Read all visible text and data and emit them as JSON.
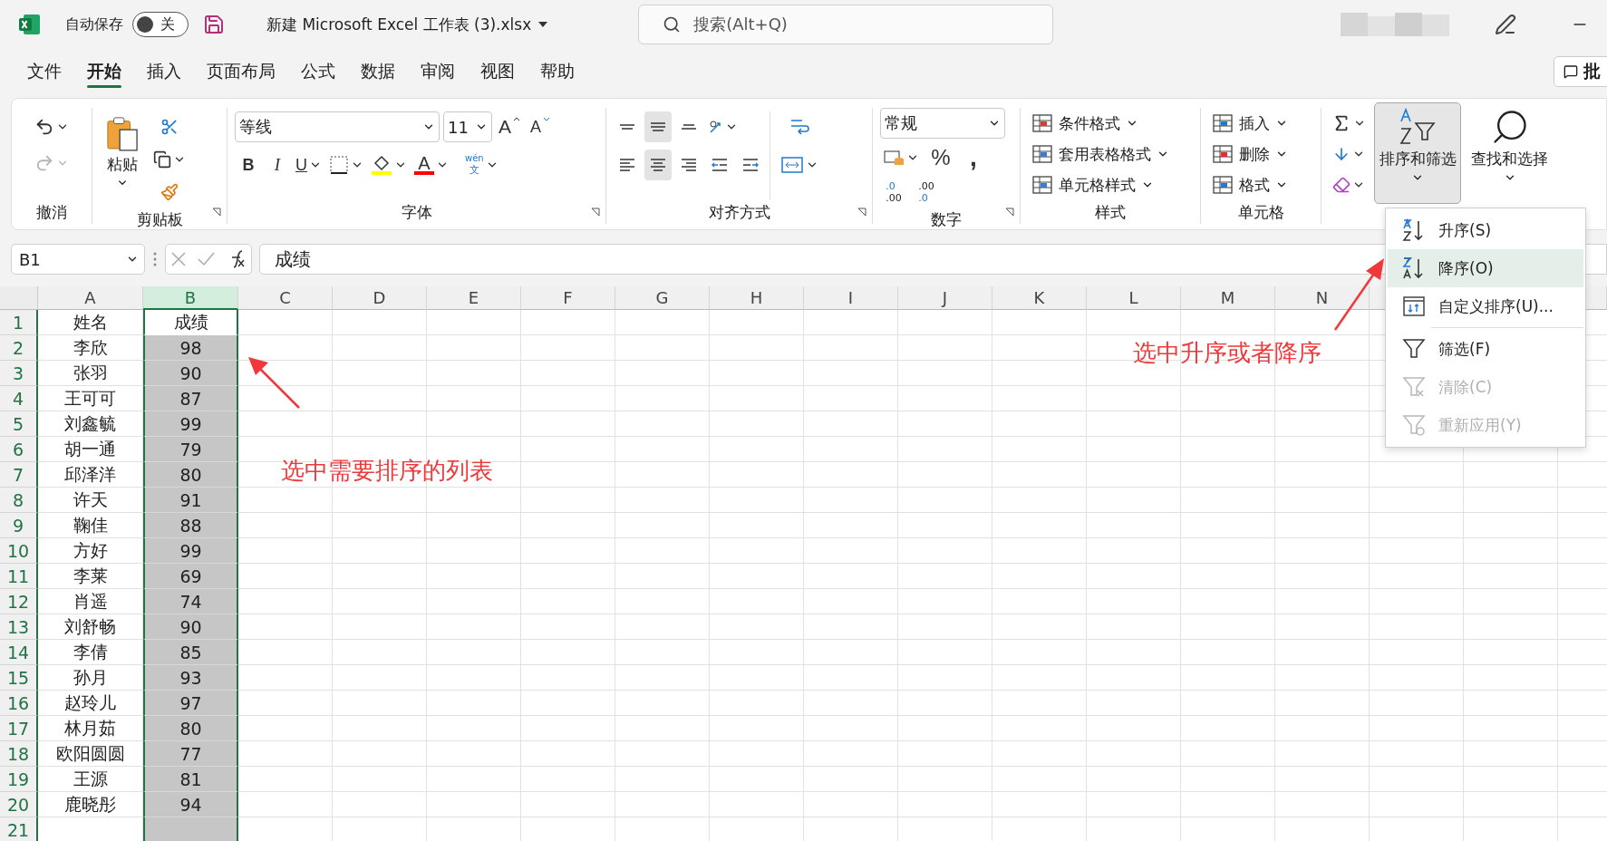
{
  "title_bar": {
    "autosave_label": "自动保存",
    "autosave": {
      "on": false,
      "state_label": "关"
    },
    "file_name": "新建 Microsoft Excel 工作表 (3).xlsx",
    "search_placeholder": "搜索(Alt+Q)"
  },
  "tabs": [
    {
      "label": "文件",
      "selected": false
    },
    {
      "label": "开始",
      "selected": true
    },
    {
      "label": "插入",
      "selected": false
    },
    {
      "label": "页面布局",
      "selected": false
    },
    {
      "label": "公式",
      "selected": false
    },
    {
      "label": "数据",
      "selected": false
    },
    {
      "label": "审阅",
      "selected": false
    },
    {
      "label": "视图",
      "selected": false
    },
    {
      "label": "帮助",
      "selected": false
    }
  ],
  "comment_button": "批",
  "ribbon": {
    "undo": {
      "label": "撤消",
      "redo_disabled": true
    },
    "clipboard": {
      "paste": "粘贴",
      "label": "剪贴板"
    },
    "font": {
      "name": "等线",
      "size": "11",
      "grow": "A",
      "shrink": "A",
      "bold": "B",
      "italic": "I",
      "underline": "U",
      "font_color": "A",
      "phonetic_top": "wén",
      "phonetic_bottom": "文",
      "label": "字体"
    },
    "alignment": {
      "label": "对齐方式",
      "vertical": [
        {
          "kind": "top",
          "selected": false
        },
        {
          "kind": "middle",
          "selected": true
        },
        {
          "kind": "bottom",
          "selected": false
        }
      ],
      "horizontal": [
        {
          "kind": "left",
          "selected": false
        },
        {
          "kind": "center",
          "selected": true
        },
        {
          "kind": "right",
          "selected": false
        },
        {
          "kind": "outdent",
          "selected": false
        },
        {
          "kind": "indent",
          "selected": false
        }
      ]
    },
    "number": {
      "format": "常规",
      "percent": "%",
      "comma": ",",
      "increase_decimal": [
        ".0",
        ".00"
      ],
      "decrease_decimal": [
        ".00",
        ".0"
      ],
      "label": "数字"
    },
    "styles": {
      "label": "样式",
      "items": [
        {
          "kind": "conditional",
          "label": "条件格式"
        },
        {
          "kind": "table",
          "label": "套用表格格式"
        },
        {
          "kind": "cell",
          "label": "单元格样式"
        }
      ]
    },
    "cells": {
      "label": "单元格",
      "items": [
        {
          "kind": "insert",
          "label": "插入"
        },
        {
          "kind": "delete",
          "label": "删除"
        },
        {
          "kind": "format",
          "label": "格式"
        }
      ]
    },
    "editing": {
      "sort_filter": {
        "label": "排序和筛选",
        "pressed": true
      },
      "find": "查找和选择"
    }
  },
  "formula_bar": {
    "name_box": "B1",
    "formula": "成绩"
  },
  "sheet": {
    "columns": [
      {
        "label": "A",
        "selected": false
      },
      {
        "label": "B",
        "selected": true
      },
      {
        "label": "C",
        "selected": false
      },
      {
        "label": "D",
        "selected": false
      },
      {
        "label": "E",
        "selected": false
      },
      {
        "label": "F",
        "selected": false
      },
      {
        "label": "G",
        "selected": false
      },
      {
        "label": "H",
        "selected": false
      },
      {
        "label": "I",
        "selected": false
      },
      {
        "label": "J",
        "selected": false
      },
      {
        "label": "K",
        "selected": false
      },
      {
        "label": "L",
        "selected": false
      },
      {
        "label": "M",
        "selected": false
      },
      {
        "label": "N",
        "selected": false
      }
    ],
    "rows": [
      {
        "number": "1",
        "active": true,
        "cells": [
          "姓名",
          "成绩"
        ]
      },
      {
        "number": "2",
        "active": false,
        "cells": [
          "李欣",
          "98"
        ]
      },
      {
        "number": "3",
        "active": false,
        "cells": [
          "张羽",
          "90"
        ]
      },
      {
        "number": "4",
        "active": false,
        "cells": [
          "王可可",
          "87"
        ]
      },
      {
        "number": "5",
        "active": false,
        "cells": [
          "刘鑫毓",
          "99"
        ]
      },
      {
        "number": "6",
        "active": false,
        "cells": [
          "胡一通",
          "79"
        ]
      },
      {
        "number": "7",
        "active": false,
        "cells": [
          "邱泽洋",
          "80"
        ]
      },
      {
        "number": "8",
        "active": false,
        "cells": [
          "许天",
          "91"
        ]
      },
      {
        "number": "9",
        "active": false,
        "cells": [
          "鞠佳",
          "88"
        ]
      },
      {
        "number": "10",
        "active": false,
        "cells": [
          "方好",
          "99"
        ]
      },
      {
        "number": "11",
        "active": false,
        "cells": [
          "李莱",
          "69"
        ]
      },
      {
        "number": "12",
        "active": false,
        "cells": [
          "肖遥",
          "74"
        ]
      },
      {
        "number": "13",
        "active": false,
        "cells": [
          "刘舒畅",
          "90"
        ]
      },
      {
        "number": "14",
        "active": false,
        "cells": [
          "李倩",
          "85"
        ]
      },
      {
        "number": "15",
        "active": false,
        "cells": [
          "孙月",
          "93"
        ]
      },
      {
        "number": "16",
        "active": false,
        "cells": [
          "赵玲儿",
          "97"
        ]
      },
      {
        "number": "17",
        "active": false,
        "cells": [
          "林月茹",
          "80"
        ]
      },
      {
        "number": "18",
        "active": false,
        "cells": [
          "欧阳圆圆",
          "77"
        ]
      },
      {
        "number": "19",
        "active": false,
        "cells": [
          "王源",
          "81"
        ]
      },
      {
        "number": "20",
        "active": false,
        "cells": [
          "鹿晓彤",
          "94"
        ]
      },
      {
        "number": "21",
        "active": false
      }
    ]
  },
  "sort_menu": {
    "items": [
      {
        "kind": "ascending",
        "label": "升序(S)",
        "selected": false,
        "disabled": false
      },
      {
        "kind": "descending",
        "label": "降序(O)",
        "selected": true,
        "disabled": false
      },
      {
        "kind": "custom",
        "label": "自定义排序(U)...",
        "selected": false,
        "disabled": false
      },
      {
        "kind": "filter",
        "label": "筛选(F)",
        "selected": false,
        "disabled": false
      },
      {
        "kind": "clear",
        "label": "清除(C)",
        "selected": false,
        "disabled": true
      },
      {
        "kind": "reapply",
        "label": "重新应用(Y)",
        "selected": false,
        "disabled": true
      }
    ]
  },
  "annotations": [
    {
      "kind": "column_note",
      "text": "选中需要排序的列表"
    },
    {
      "kind": "menu_note",
      "text": "选中升序或者降序"
    }
  ]
}
